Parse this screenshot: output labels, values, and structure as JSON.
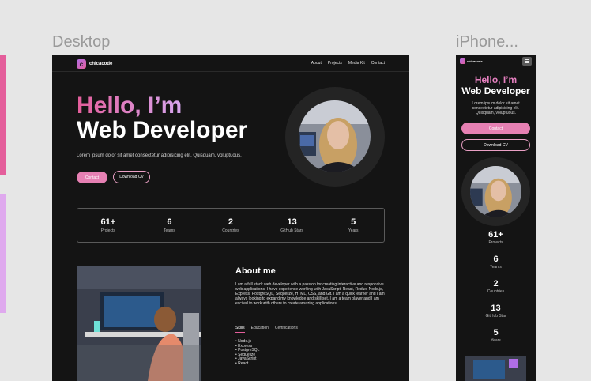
{
  "frames": {
    "desktop_title": "Desktop",
    "phone_title": "iPhone..."
  },
  "brand": {
    "name": "chicacode",
    "mark": "c",
    "accent": "#e45e9b",
    "accent2": "#d7a6ef"
  },
  "nav": {
    "links": [
      "About",
      "Projects",
      "Media Kit",
      "Contact"
    ]
  },
  "hero": {
    "greeting": "Hello, I’m",
    "role": "Web Developer",
    "lead": "Lorem ipsum dolor sit amet consectetur adipisicing elit. Quisquam, voluptuous.",
    "contact_label": "Contact",
    "cv_label": "Download CV"
  },
  "stats": [
    {
      "value": "61+",
      "label": "Projects"
    },
    {
      "value": "6",
      "label": "Teams"
    },
    {
      "value": "2",
      "label": "Countries"
    },
    {
      "value": "13",
      "label": "GitHub Stars"
    },
    {
      "value": "5",
      "label": "Years"
    }
  ],
  "about": {
    "title": "About me",
    "text": "I am a full stack web developer with a passion for creating interactive and responsive web applications. I have experience working with JavaScript, React, Redux, Node.js, Express, PostgreSQL, Sequelize, HTML, CSS, and Git. I am a quick learner and I am always looking to expand my knowledge and skill set. I am a team player and I am excited to work with others to create amazing applications.",
    "tabs": [
      "Skills",
      "Education",
      "Certifications"
    ],
    "active_tab": "Skills",
    "skills": [
      "Node.js",
      "Express",
      "PostgreSQL",
      "Sequelize",
      "JavaScript",
      "React"
    ]
  },
  "phone": {
    "lead": "Lorem ipsum dolor sit amet consectetur adipisicing elit. Quisquam, voluptuous.",
    "stats": [
      {
        "value": "61+",
        "label": "Projects"
      },
      {
        "value": "6",
        "label": "Teams"
      },
      {
        "value": "2",
        "label": "Countries"
      },
      {
        "value": "13",
        "label": "GitHub Star"
      },
      {
        "value": "5",
        "label": "Years"
      }
    ]
  }
}
